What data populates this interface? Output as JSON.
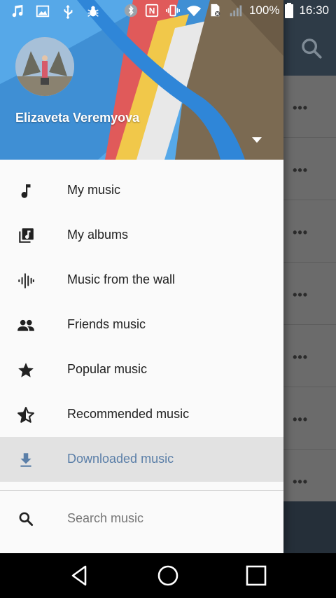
{
  "statusbar": {
    "battery": "100%",
    "time": "16:30",
    "left_icons": [
      "music-note-icon",
      "image-icon",
      "usb-icon",
      "bug-icon"
    ],
    "right_icons": [
      "bluetooth-icon",
      "nfc-icon",
      "vibrate-icon",
      "wifi-icon",
      "no-sim-icon",
      "signal-icon",
      "battery-icon"
    ]
  },
  "drawer": {
    "user_name": "Elizaveta Veremyova",
    "menu": [
      {
        "label": "My music",
        "icon": "music-note-icon",
        "active": false
      },
      {
        "label": "My albums",
        "icon": "album-icon",
        "active": false
      },
      {
        "label": "Music from the wall",
        "icon": "waveform-icon",
        "active": false
      },
      {
        "label": "Friends music",
        "icon": "people-icon",
        "active": false
      },
      {
        "label": "Popular music",
        "icon": "star-icon",
        "active": false
      },
      {
        "label": "Recommended music",
        "icon": "star-half-icon",
        "active": false
      },
      {
        "label": "Downloaded music",
        "icon": "download-icon",
        "active": true
      }
    ],
    "search_label": "Search music"
  },
  "background": {
    "row_menu_glyph": "•••"
  },
  "colors": {
    "accent": "#5b7fa8",
    "toolbar": "#2e3b47",
    "active_bg": "#e2e2e2"
  }
}
